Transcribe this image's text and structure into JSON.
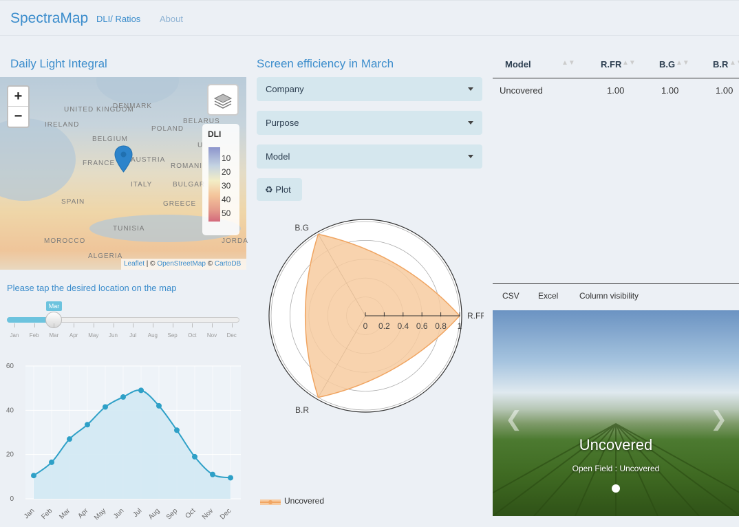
{
  "nav": {
    "brand": "SpectraMap",
    "links": [
      "DLI/ Ratios",
      "About"
    ]
  },
  "left": {
    "title": "Daily Light Integral",
    "map": {
      "legend_title": "DLI",
      "legend_ticks": [
        "10",
        "20",
        "30",
        "40",
        "50"
      ],
      "countries": [
        "DENMARK",
        "UNITED KINGDOM",
        "IRELAND",
        "BELGIUM",
        "FRANCE",
        "AUSTRIA",
        "POLAND",
        "BELARUS",
        "U",
        "ROMANI",
        "ITALY",
        "BULGAR",
        "SPAIN",
        "GREECE",
        "TUNISIA",
        "MOROCCO",
        "ALGERIA",
        "JORDA"
      ],
      "attribution": {
        "leaflet": "Leaflet",
        "sep": " | © ",
        "osm": "OpenStreetMap",
        "mid": " © ",
        "carto": "CartoDB"
      },
      "zoom_in": "+",
      "zoom_out": "−"
    },
    "hint": "Please tap the desired location on the map",
    "slider": {
      "value": "Mar",
      "months": [
        "Jan",
        "Feb",
        "Mar",
        "Apr",
        "May",
        "Jun",
        "Jul",
        "Aug",
        "Sep",
        "Oct",
        "Nov",
        "Dec"
      ]
    }
  },
  "middle": {
    "title": "Screen efficiency in March",
    "selects": [
      "Company",
      "Purpose",
      "Model"
    ],
    "plot_button": "Plot",
    "plot_icon": "recycle-icon",
    "radar": {
      "axes": [
        "R.FR",
        "B.G",
        "B.R"
      ],
      "radial_ticks": [
        "0",
        "0.2",
        "0.4",
        "0.6",
        "0.8",
        "1"
      ],
      "legend": "Uncovered"
    }
  },
  "right": {
    "table": {
      "columns": [
        "Model",
        "R.FR",
        "B.G",
        "B.R"
      ],
      "rows": [
        [
          "Uncovered",
          "1.00",
          "1.00",
          "1.00"
        ]
      ]
    },
    "buttons": [
      "CSV",
      "Excel",
      "Column visibility"
    ],
    "carousel": {
      "title": "Uncovered",
      "subtitle": "Open Field : Uncovered"
    }
  },
  "colors": {
    "accent": "#3c8dcc",
    "line": "#2ea0c7",
    "radar_fill": "#f7cba0"
  },
  "chart_data": [
    {
      "type": "area",
      "x": [
        "Jan",
        "Feb",
        "Mar",
        "Apr",
        "May",
        "Jun",
        "Jul",
        "Aug",
        "Sep",
        "Oct",
        "Nov",
        "Dec"
      ],
      "values": [
        10.5,
        16.5,
        27,
        33.5,
        41.5,
        46,
        49,
        42,
        31,
        19,
        11,
        9.5
      ],
      "ylim": [
        0,
        60
      ],
      "yticks": [
        "0",
        "20",
        "40",
        "60"
      ],
      "grid": true
    },
    {
      "type": "radar",
      "categories": [
        "R.FR",
        "B.G",
        "B.R"
      ],
      "series": [
        {
          "name": "Uncovered",
          "values": [
            1.0,
            1.0,
            1.0
          ]
        }
      ],
      "rlim": [
        0,
        1
      ]
    }
  ]
}
